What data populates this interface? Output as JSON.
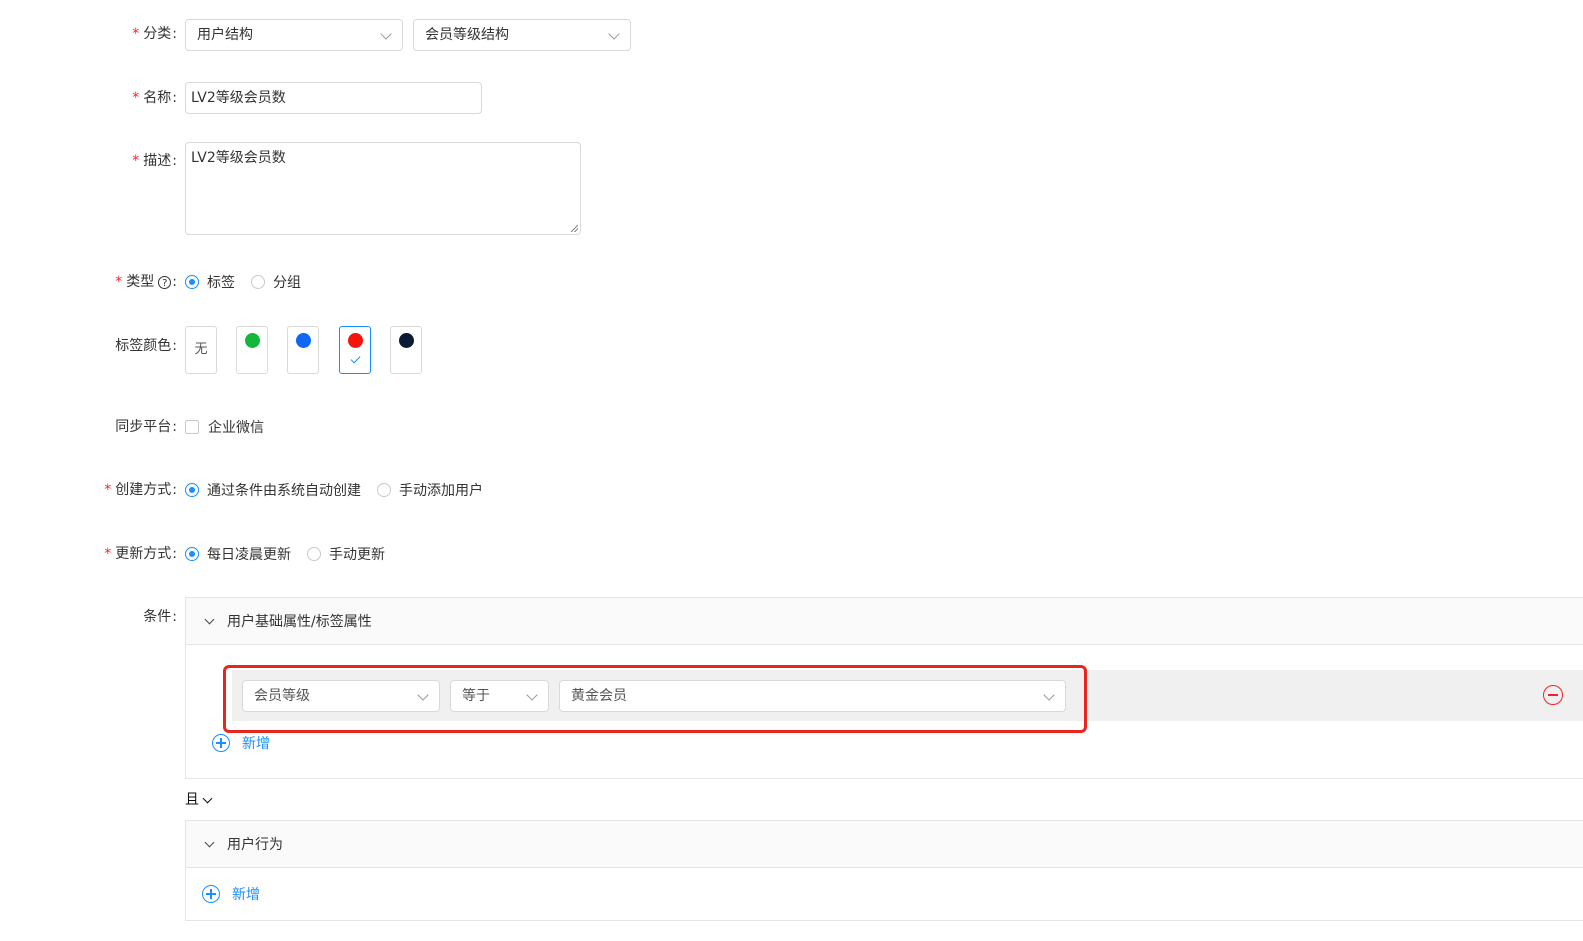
{
  "form": {
    "category": {
      "label": "分类",
      "primary_value": "用户结构",
      "secondary_value": "会员等级结构"
    },
    "name": {
      "label": "名称",
      "value": "LV2等级会员数"
    },
    "description": {
      "label": "描述",
      "value": "LV2等级会员数"
    },
    "type": {
      "label": "类型",
      "help_icon": "question-circle-icon",
      "options": [
        "标签",
        "分组"
      ],
      "selected": "标签"
    },
    "tag_color": {
      "label": "标签颜色",
      "none_label": "无",
      "swatches": [
        "#13b739",
        "#1067f5",
        "#f5140c",
        "#0b1b33"
      ],
      "selected": "#f5140c"
    },
    "sync_platform": {
      "label": "同步平台",
      "option": "企业微信",
      "checked": false
    },
    "create_method": {
      "label": "创建方式",
      "options": [
        "通过条件由系统自动创建",
        "手动添加用户"
      ],
      "selected": "通过条件由系统自动创建"
    },
    "update_method": {
      "label": "更新方式",
      "options": [
        "每日凌晨更新",
        "手动更新"
      ],
      "selected": "每日凌晨更新"
    },
    "conditions": {
      "label": "条件",
      "group1": {
        "title": "用户基础属性/标签属性",
        "rule": {
          "field": "会员等级",
          "operator": "等于",
          "value": "黄金会员"
        },
        "add_label": "新增"
      },
      "logic": "且",
      "group2": {
        "title": "用户行为",
        "add_label": "新增"
      }
    }
  },
  "colors": {
    "accent": "#1890ff",
    "required": "#f5222d",
    "highlight": "#e8261e"
  }
}
